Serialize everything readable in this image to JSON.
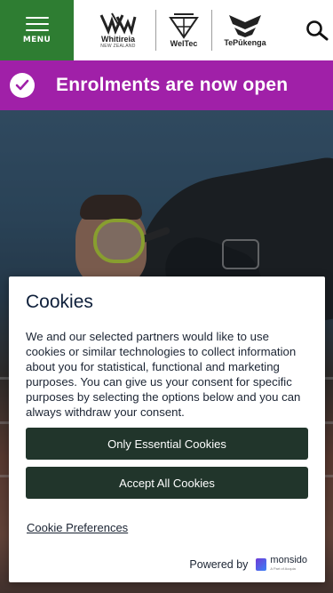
{
  "header": {
    "menu_label": "MENU",
    "logos": [
      {
        "name": "Whitireia",
        "sub": "NEW ZEALAND",
        "icon": "whitireia-logo-icon"
      },
      {
        "name": "WelTec",
        "icon": "weltec-logo-icon"
      },
      {
        "name": "TePūkenga",
        "icon": "tepukenga-logo-icon"
      }
    ],
    "search_icon": "search-icon",
    "menu_icon": "hamburger-icon"
  },
  "banner": {
    "text": "Enrolments are now open",
    "icon": "check-circle-icon"
  },
  "cookie": {
    "title": "Cookies",
    "body": "We and our selected partners would like to use cookies or similar technologies to collect information about you for statistical, functional and marketing purposes. You can give us your consent for specific purposes by selecting the options below and you can always withdraw your consent.",
    "essential_button": "Only Essential Cookies",
    "accept_button": "Accept All Cookies",
    "preferences_link": "Cookie Preferences",
    "powered_by": "Powered by",
    "brand": "monsido",
    "brand_tag": "A Part of Acquia"
  },
  "colors": {
    "menu_green": "#2e7d32",
    "banner_purple": "#a020a8",
    "button_dark_green": "#21352b"
  }
}
